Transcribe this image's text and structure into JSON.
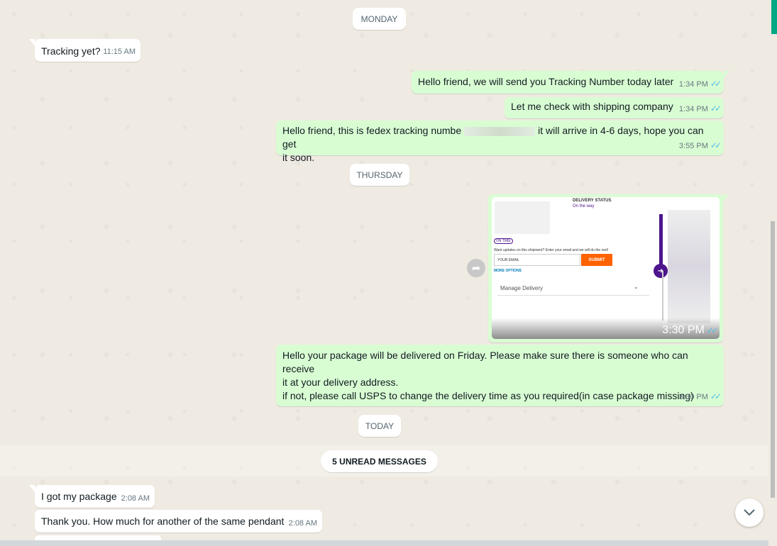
{
  "dates": {
    "monday": "MONDAY",
    "thursday": "THURSDAY",
    "today": "TODAY"
  },
  "unread": "5 UNREAD MESSAGES",
  "messages": [
    {
      "dir": "in",
      "text": "Tracking yet?",
      "time": "11:15 AM"
    },
    {
      "dir": "out",
      "text": "Hello friend, we will send you Tracking Number today later",
      "time": "1:34 PM",
      "status": "read"
    },
    {
      "dir": "out",
      "text": "Let me check with shipping company",
      "time": "1:34 PM",
      "status": "read"
    },
    {
      "dir": "out",
      "text_a": "Hello friend, this is fedex tracking numbe",
      "text_b": "it will arrive in 4-6 days, hope you can get",
      "text_c": "it soon.",
      "time": "3:55 PM",
      "status": "read"
    },
    {
      "dir": "out",
      "type": "image",
      "time": "3:30 PM",
      "status": "read",
      "image": {
        "delivery_status": "DELIVERY STATUS",
        "on_the_way": "On the way",
        "badge": "ON TIME",
        "prompt": "Want updates on this shipment? Enter your email and we will do the rest!",
        "email_placeholder": "YOUR EMAIL",
        "submit": "SUBMIT",
        "more_options": "MORE OPTIONS",
        "manage_delivery": "Manage Delivery"
      }
    },
    {
      "dir": "out",
      "line1": "Hello your package will be delivered on Friday. Please make sure there is someone who can receive",
      "line2": "it at your delivery address.",
      "line3": "if not, please call USPS to change the delivery time as you required(in case package missing)",
      "time": "3:30 PM",
      "status": "read"
    },
    {
      "dir": "in",
      "text": "I got my package",
      "time": "2:08 AM"
    },
    {
      "dir": "in",
      "text": "Thank you. How much for another of the same pendant",
      "time": "2:08 AM"
    }
  ],
  "icons": {
    "read_receipt": "✓✓",
    "forward": "➦",
    "chevron_down": "chevron-down-icon"
  }
}
